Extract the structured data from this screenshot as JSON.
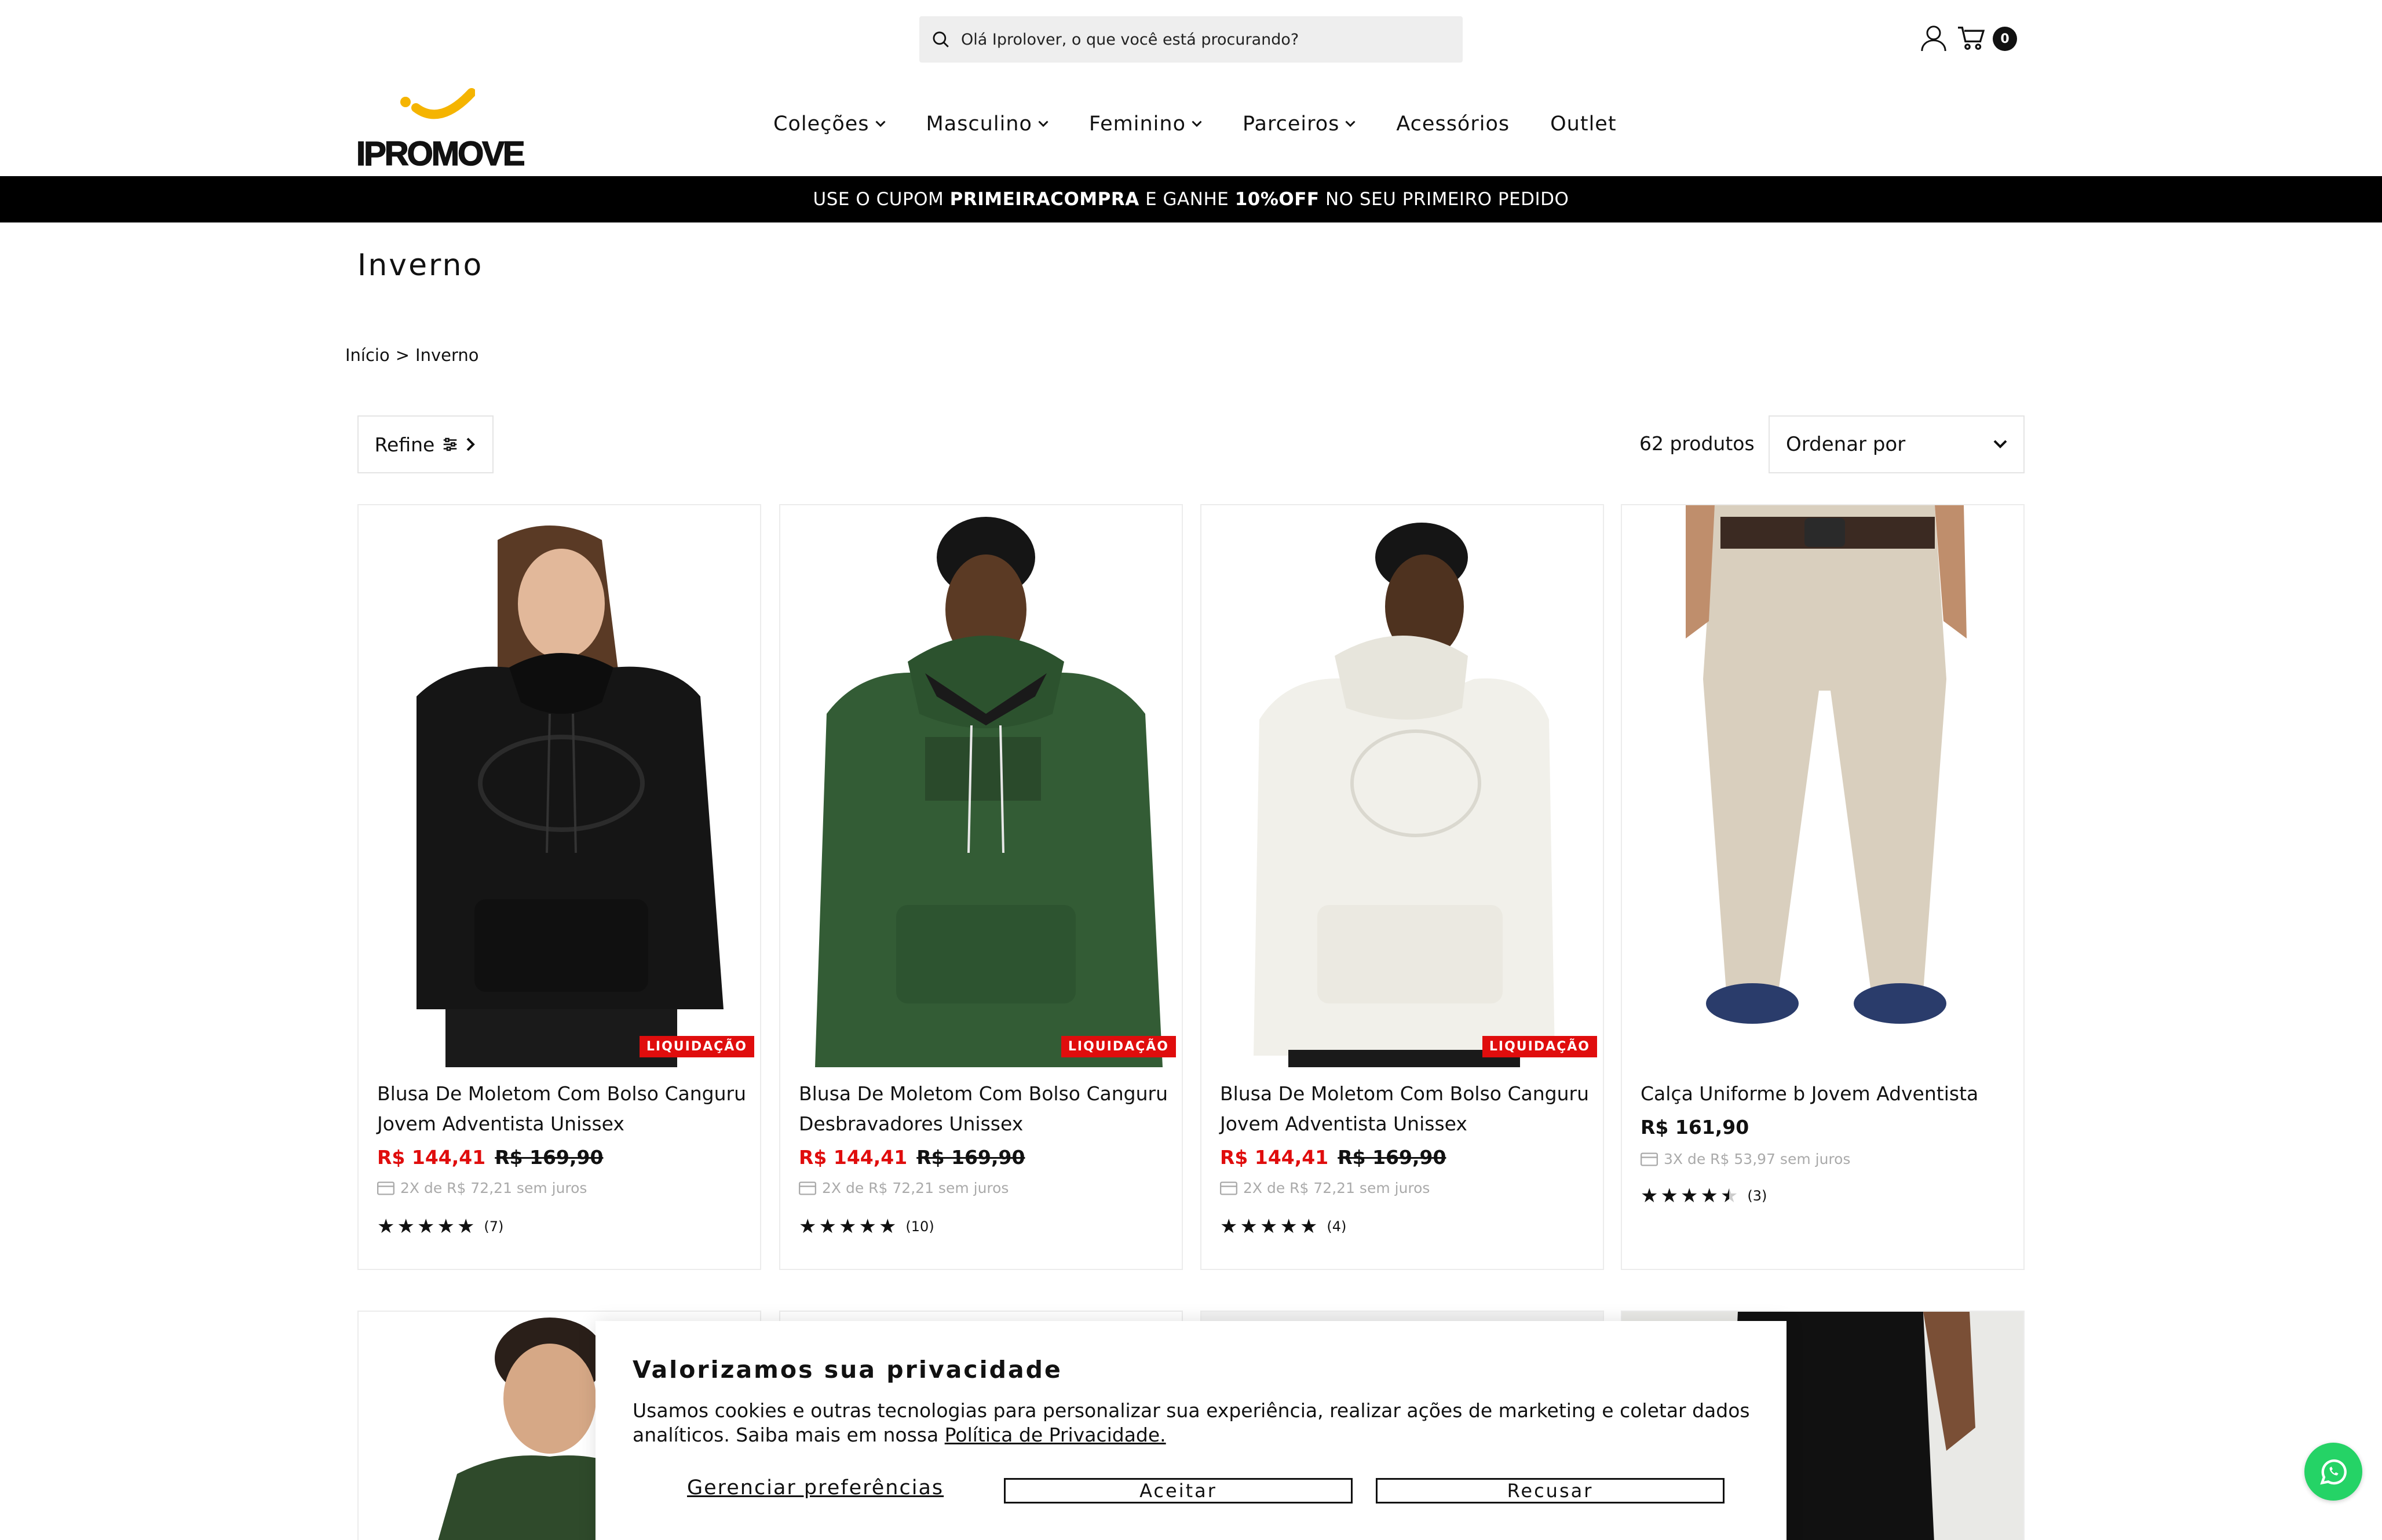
{
  "header": {
    "search_placeholder": "Olá Iprolover, o que você está procurando?",
    "cart_count": "0",
    "logo_text": "IPROMOVE"
  },
  "nav": {
    "items": [
      {
        "label": "Coleções",
        "has_dropdown": true
      },
      {
        "label": "Masculino",
        "has_dropdown": true
      },
      {
        "label": "Feminino",
        "has_dropdown": true
      },
      {
        "label": "Parceiros",
        "has_dropdown": true
      },
      {
        "label": "Acessórios",
        "has_dropdown": false
      },
      {
        "label": "Outlet",
        "has_dropdown": false
      }
    ]
  },
  "promo": {
    "prefix": "USE O CUPOM ",
    "coupon": "PRIMEIRACOMPRA",
    "middle": " E GANHE ",
    "discount": "10%OFF",
    "suffix": " NO SEU PRIMEIRO PEDIDO"
  },
  "page": {
    "title": "Inverno",
    "breadcrumb": {
      "home": "Início",
      "separator": ">",
      "current": "Inverno"
    },
    "refine_label": "Refine",
    "product_count": "62 produtos",
    "sort_label": "Ordenar por"
  },
  "products": [
    {
      "name": "Blusa De Moletom Com Bolso Canguru Jovem Adventista Unissex",
      "price_sale": "R$ 144,41",
      "price_old": "R$ 169,90",
      "installment": "2X de R$ 72,21 sem juros",
      "rating": 5,
      "reviews": "(7)",
      "badge": "LIQUIDAÇÃO",
      "color": "#141414"
    },
    {
      "name": "Blusa De Moletom Com Bolso Canguru Desbravadores Unissex",
      "price_sale": "R$ 144,41",
      "price_old": "R$ 169,90",
      "installment": "2X de R$ 72,21 sem juros",
      "rating": 5,
      "reviews": "(10)",
      "badge": "LIQUIDAÇÃO",
      "color": "#2f5a32"
    },
    {
      "name": "Blusa De Moletom Com Bolso Canguru Jovem Adventista Unissex",
      "price_sale": "R$ 144,41",
      "price_old": "R$ 169,90",
      "installment": "2X de R$ 72,21 sem juros",
      "rating": 5,
      "reviews": "(4)",
      "badge": "LIQUIDAÇÃO",
      "color": "#f2f1ec"
    },
    {
      "name": "Calça Uniforme b Jovem Adventista",
      "price_regular": "R$ 161,90",
      "installment": "3X de R$ 53,97 sem juros",
      "rating": 4.5,
      "reviews": "(3)",
      "color": "#d8cdbb"
    }
  ],
  "cookie": {
    "title": "Valorizamos sua privacidade",
    "text": "Usamos cookies e outras tecnologias para personalizar sua experiência, realizar ações de marketing e coletar dados analíticos. Saiba mais em nossa ",
    "policy_link": "Política de Privacidade.",
    "manage": "Gerenciar preferências",
    "accept": "Aceitar",
    "reject": "Recusar"
  },
  "colors": {
    "sale_red": "#e00d0d",
    "promo_bg": "#000000",
    "whatsapp": "#25d366",
    "logo_yellow": "#f5b400"
  }
}
